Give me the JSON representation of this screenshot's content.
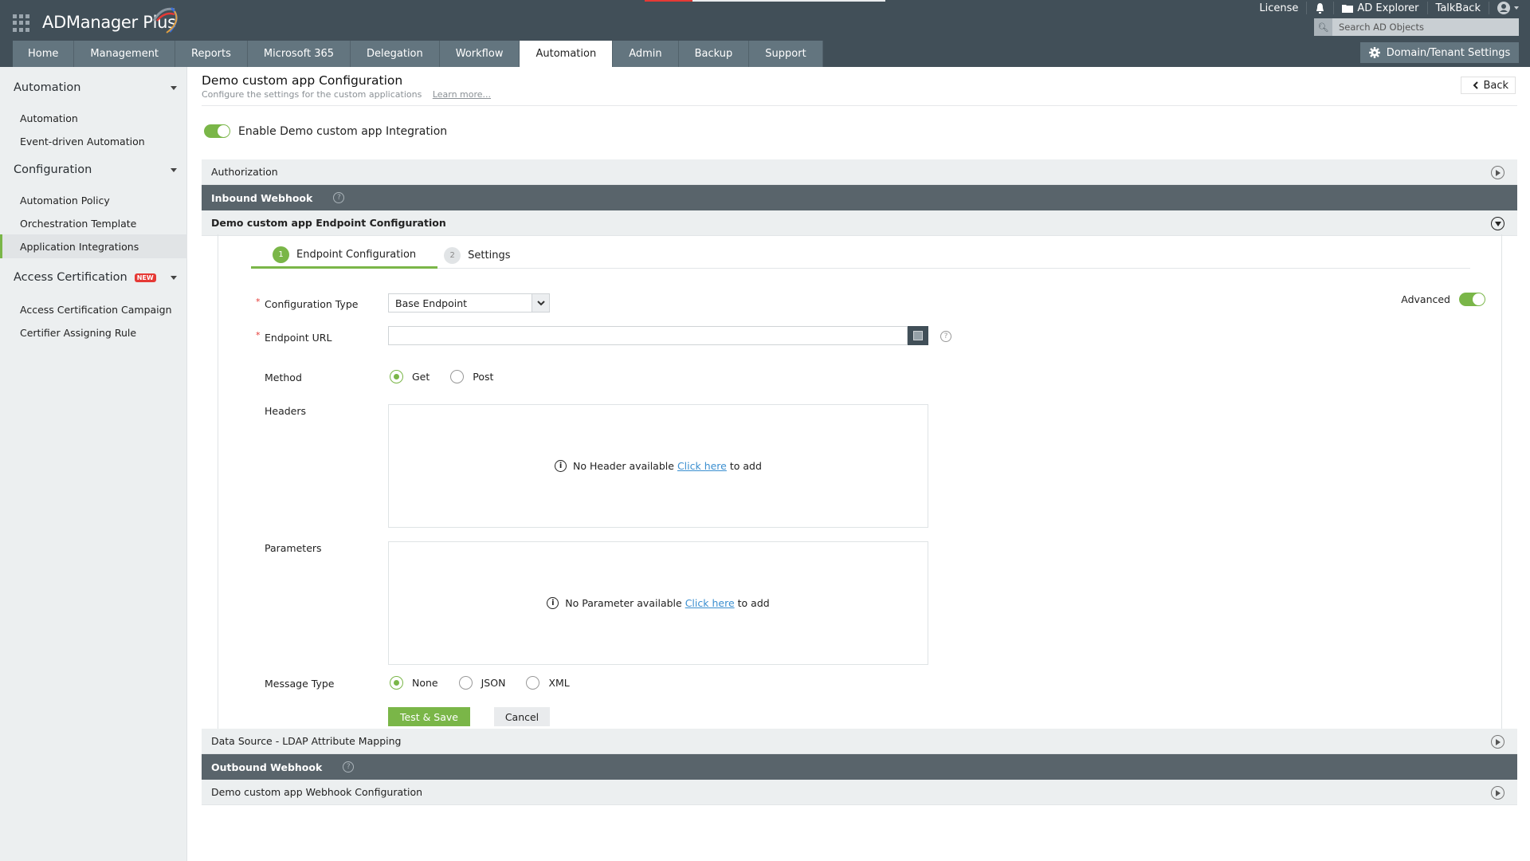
{
  "app": {
    "name": "ADManager Plus",
    "brand_green": "#7ab648",
    "header_bg": "#414f58"
  },
  "top_links": {
    "license": "License",
    "ad_explorer": "AD Explorer",
    "talkback": "TalkBack",
    "search_placeholder": "Search AD Objects",
    "domain_settings": "Domain/Tenant Settings"
  },
  "nav": {
    "tabs": [
      {
        "label": "Home"
      },
      {
        "label": "Management"
      },
      {
        "label": "Reports"
      },
      {
        "label": "Microsoft 365"
      },
      {
        "label": "Delegation"
      },
      {
        "label": "Workflow"
      },
      {
        "label": "Automation",
        "active": true
      },
      {
        "label": "Admin"
      },
      {
        "label": "Backup"
      },
      {
        "label": "Support"
      }
    ]
  },
  "sidebar": {
    "groups": [
      {
        "label": "Automation",
        "items": [
          {
            "label": "Automation"
          },
          {
            "label": "Event-driven Automation"
          }
        ]
      },
      {
        "label": "Configuration",
        "items": [
          {
            "label": "Automation Policy"
          },
          {
            "label": "Orchestration Template"
          },
          {
            "label": "Application Integrations",
            "active": true
          }
        ]
      },
      {
        "label": "Access Certification",
        "badge": "NEW",
        "items": [
          {
            "label": "Access Certification Campaign"
          },
          {
            "label": "Certifier Assigning Rule"
          }
        ]
      }
    ]
  },
  "page": {
    "title": "Demo custom app Configuration",
    "subtitle": "Configure the settings for the custom applications",
    "learn_more": "Learn more...",
    "back": "Back",
    "enable_label": "Enable Demo custom app Integration",
    "enabled": true
  },
  "sections": {
    "authorization": "Authorization",
    "inbound_webhook": "Inbound Webhook",
    "endpoint_config": "Demo custom app Endpoint Configuration",
    "data_source": "Data Source - LDAP Attribute Mapping",
    "outbound_webhook": "Outbound Webhook",
    "webhook_config": "Demo custom app Webhook Configuration"
  },
  "steps": [
    {
      "num": "1",
      "label": "Endpoint Configuration",
      "active": true
    },
    {
      "num": "2",
      "label": "Settings"
    }
  ],
  "form": {
    "config_type_label": "Configuration Type",
    "config_type_value": "Base Endpoint",
    "endpoint_url_label": "Endpoint URL",
    "endpoint_url_value": "",
    "advanced_label": "Advanced",
    "advanced_on": true,
    "method_label": "Method",
    "method_options": [
      "Get",
      "Post"
    ],
    "method_selected": "Get",
    "headers_label": "Headers",
    "headers_empty": "No Header available",
    "parameters_label": "Parameters",
    "parameters_empty": "No Parameter available",
    "click_here": "Click here",
    "to_add": "to add",
    "message_type_label": "Message Type",
    "message_type_options": [
      "None",
      "JSON",
      "XML"
    ],
    "message_type_selected": "None",
    "required_mark": "*",
    "help_glyph": "?",
    "info_glyph": "i"
  },
  "buttons": {
    "test_save": "Test & Save",
    "cancel": "Cancel"
  }
}
